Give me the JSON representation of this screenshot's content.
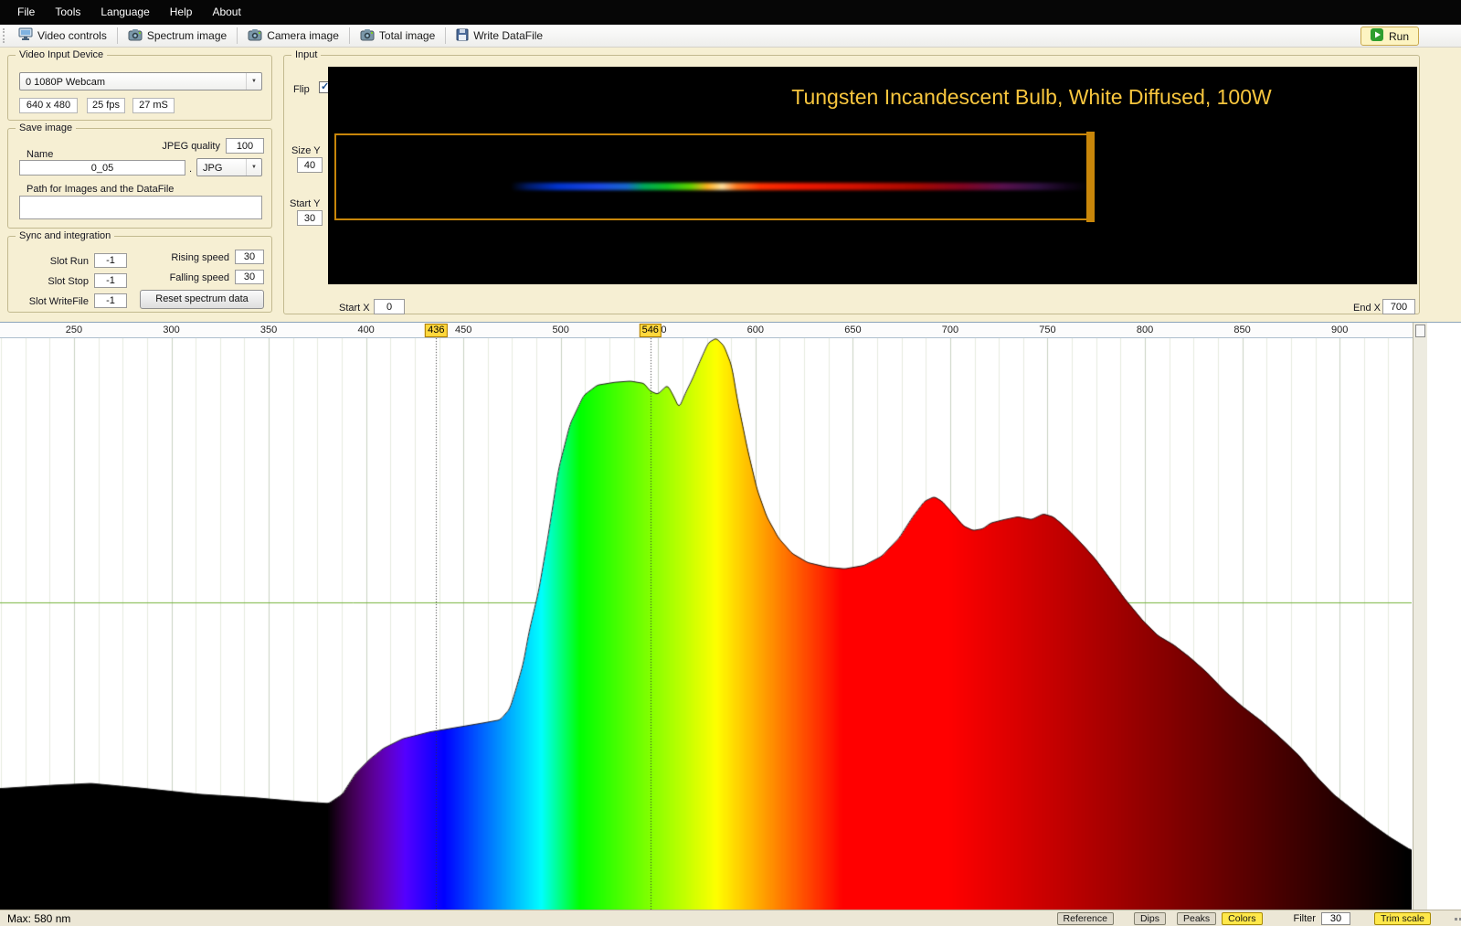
{
  "menu": {
    "items": [
      "File",
      "Tools",
      "Language",
      "Help",
      "About"
    ]
  },
  "toolbar": {
    "buttons": [
      {
        "label": "Video controls",
        "icon": "video-controls-icon"
      },
      {
        "label": "Spectrum image",
        "icon": "camera-icon"
      },
      {
        "label": "Camera image",
        "icon": "camera-icon"
      },
      {
        "label": "Total image",
        "icon": "camera-icon"
      },
      {
        "label": "Write DataFile",
        "icon": "write-datafile-icon"
      }
    ],
    "run_label": "Run"
  },
  "video_input": {
    "title": "Video Input Device",
    "device": "0 1080P Webcam",
    "resolution": "640 x 480",
    "fps": "25 fps",
    "exposure": "27 mS"
  },
  "save_image": {
    "title": "Save image",
    "name_label": "Name",
    "name": "0_05",
    "jpeg_quality_label": "JPEG quality",
    "jpeg_quality": "100",
    "dot": ".",
    "format": "JPG",
    "path_label": "Path for Images and the DataFile",
    "path": ""
  },
  "sync": {
    "title": "Sync and integration",
    "slot_run_label": "Slot Run",
    "slot_run": "-1",
    "slot_stop_label": "Slot Stop",
    "slot_stop": "-1",
    "slot_writefile_label": "Slot WriteFile",
    "slot_writefile": "-1",
    "rising_label": "Rising speed",
    "rising_speed": "30",
    "falling_label": "Falling speed",
    "falling_speed": "30",
    "reset_label": "Reset spectrum data"
  },
  "input_panel": {
    "title": "Input",
    "flip_label": "Flip",
    "flip_checked": true,
    "size_y_label": "Size Y",
    "size_y": "40",
    "start_y_label": "Start Y",
    "start_y": "30",
    "start_x_label": "Start X",
    "start_x": "0",
    "end_x_label": "End X",
    "end_x": "700",
    "overlay_title": "Tungsten Incandescent Bulb, White Diffused, 100W",
    "overlay_color": "#f8c63e",
    "selection_color": "#c8860a",
    "strip_stops": [
      [
        0,
        "#000000"
      ],
      [
        0.03,
        "#001a66"
      ],
      [
        0.08,
        "#0033cc"
      ],
      [
        0.15,
        "#1a47e6"
      ],
      [
        0.2,
        "#1766cc"
      ],
      [
        0.23,
        "#00a85a"
      ],
      [
        0.27,
        "#10c020"
      ],
      [
        0.31,
        "#60d000"
      ],
      [
        0.34,
        "#ffb020"
      ],
      [
        0.365,
        "#ffe0a0"
      ],
      [
        0.39,
        "#ff7820"
      ],
      [
        0.43,
        "#ff3000"
      ],
      [
        0.5,
        "#f01800"
      ],
      [
        0.6,
        "#d01000"
      ],
      [
        0.7,
        "#a80800"
      ],
      [
        0.78,
        "#800420"
      ],
      [
        0.85,
        "#58104e"
      ],
      [
        0.91,
        "#301040"
      ],
      [
        0.96,
        "#100418"
      ],
      [
        1,
        "#000000"
      ]
    ]
  },
  "status_bar": {
    "max_label": "Max: 580 nm",
    "buttons": [
      {
        "label": "Reference",
        "highlight": false
      },
      {
        "label": "Dips",
        "highlight": false
      },
      {
        "label": "Peaks",
        "highlight": false
      },
      {
        "label": "Colors",
        "highlight": true
      }
    ],
    "filter_label": "Filter",
    "filter_value": "30",
    "trim_label": "Trim scale",
    "highlight_color": "#ffe84a"
  },
  "chart_data": {
    "type": "area",
    "title": "",
    "x_axis": {
      "range": [
        212,
        937
      ],
      "ticks": [
        250,
        300,
        350,
        400,
        450,
        500,
        550,
        600,
        650,
        700,
        750,
        800,
        850,
        900
      ],
      "markers": [
        436,
        546
      ]
    },
    "ylim": [
      0,
      1
    ],
    "grid": {
      "minor_step_nm": 12.5,
      "major_step_nm": 50,
      "h_lines": [
        0.538
      ],
      "h_line_color": "#76b43e"
    },
    "peak_nm": 580,
    "spectrum": [
      [
        212,
        0.213
      ],
      [
        240,
        0.219
      ],
      [
        259,
        0.222
      ],
      [
        287,
        0.213
      ],
      [
        315,
        0.203
      ],
      [
        343,
        0.197
      ],
      [
        367,
        0.19
      ],
      [
        381,
        0.187
      ],
      [
        388,
        0.203
      ],
      [
        395,
        0.24
      ],
      [
        402,
        0.264
      ],
      [
        409,
        0.283
      ],
      [
        419,
        0.3
      ],
      [
        433,
        0.312
      ],
      [
        447,
        0.32
      ],
      [
        461,
        0.328
      ],
      [
        469,
        0.333
      ],
      [
        474,
        0.352
      ],
      [
        477,
        0.384
      ],
      [
        481,
        0.432
      ],
      [
        484,
        0.488
      ],
      [
        489,
        0.56
      ],
      [
        494,
        0.66
      ],
      [
        499,
        0.77
      ],
      [
        505,
        0.85
      ],
      [
        512,
        0.9
      ],
      [
        519,
        0.918
      ],
      [
        528,
        0.923
      ],
      [
        536,
        0.925
      ],
      [
        543,
        0.921
      ],
      [
        546,
        0.908
      ],
      [
        550,
        0.902
      ],
      [
        555,
        0.918
      ],
      [
        558,
        0.9
      ],
      [
        561,
        0.878
      ],
      [
        564,
        0.902
      ],
      [
        568,
        0.93
      ],
      [
        572,
        0.962
      ],
      [
        576,
        0.992
      ],
      [
        580,
        1.0
      ],
      [
        584,
        0.987
      ],
      [
        588,
        0.952
      ],
      [
        591,
        0.891
      ],
      [
        596,
        0.808
      ],
      [
        601,
        0.736
      ],
      [
        606,
        0.688
      ],
      [
        612,
        0.651
      ],
      [
        619,
        0.624
      ],
      [
        627,
        0.608
      ],
      [
        637,
        0.6
      ],
      [
        646,
        0.597
      ],
      [
        656,
        0.603
      ],
      [
        665,
        0.619
      ],
      [
        674,
        0.651
      ],
      [
        681,
        0.688
      ],
      [
        687,
        0.715
      ],
      [
        692,
        0.723
      ],
      [
        696,
        0.715
      ],
      [
        703,
        0.688
      ],
      [
        707,
        0.672
      ],
      [
        712,
        0.664
      ],
      [
        717,
        0.667
      ],
      [
        721,
        0.677
      ],
      [
        728,
        0.683
      ],
      [
        735,
        0.688
      ],
      [
        742,
        0.683
      ],
      [
        748,
        0.693
      ],
      [
        753,
        0.688
      ],
      [
        757,
        0.677
      ],
      [
        762,
        0.661
      ],
      [
        768,
        0.64
      ],
      [
        775,
        0.613
      ],
      [
        782,
        0.581
      ],
      [
        790,
        0.544
      ],
      [
        799,
        0.507
      ],
      [
        807,
        0.48
      ],
      [
        815,
        0.464
      ],
      [
        823,
        0.443
      ],
      [
        832,
        0.416
      ],
      [
        841,
        0.384
      ],
      [
        850,
        0.357
      ],
      [
        860,
        0.331
      ],
      [
        869,
        0.304
      ],
      [
        879,
        0.272
      ],
      [
        888,
        0.235
      ],
      [
        897,
        0.203
      ],
      [
        907,
        0.176
      ],
      [
        916,
        0.152
      ],
      [
        926,
        0.128
      ],
      [
        937,
        0.105
      ]
    ]
  }
}
